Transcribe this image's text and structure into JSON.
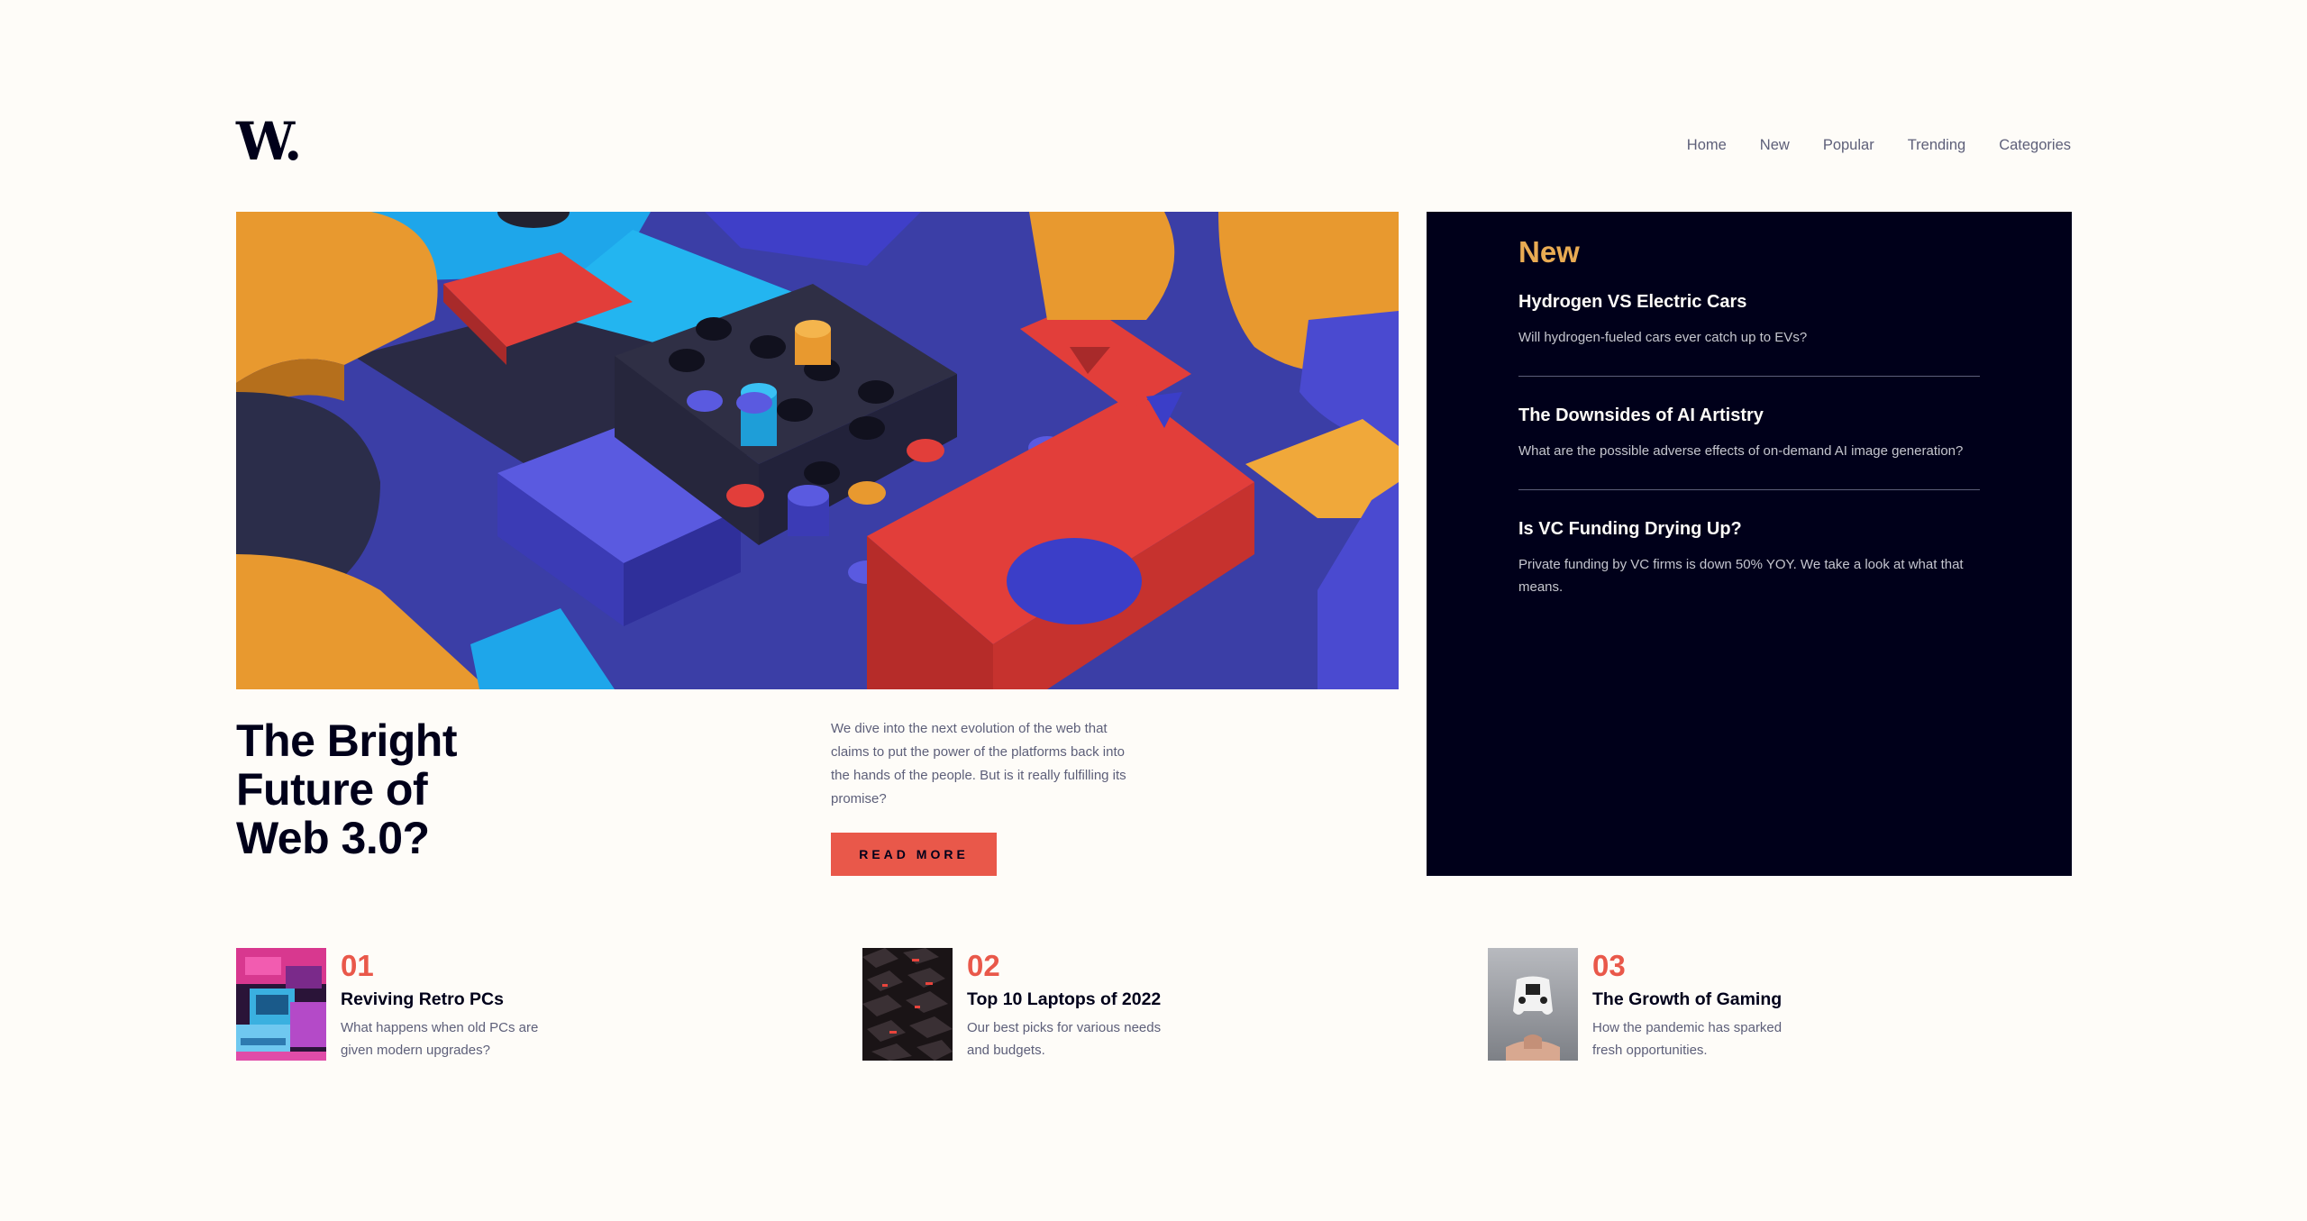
{
  "header": {
    "logo": "W.",
    "nav": [
      "Home",
      "New",
      "Popular",
      "Trending",
      "Categories"
    ]
  },
  "hero": {
    "title": "The Bright\nFuture of\nWeb 3.0?",
    "description": "We dive into the next evolution of the web that claims to put the power of the platforms back into the hands of the people. But is it really fulfilling its promise?",
    "button": "READ MORE",
    "image_icon": "abstract-3d-blocks-image"
  },
  "new_panel": {
    "heading": "New",
    "items": [
      {
        "title": "Hydrogen VS Electric Cars",
        "text": "Will hydrogen-fueled cars ever catch up to EVs?"
      },
      {
        "title": "The Downsides of AI Artistry",
        "text": "What are the possible adverse effects of on-demand AI image generation?"
      },
      {
        "title": "Is VC Funding Drying Up?",
        "text": "Private funding by VC firms is down 50% YOY. We take a look at what that means."
      }
    ]
  },
  "cards": [
    {
      "num": "01",
      "title": "Reviving Retro PCs",
      "text": "What happens when old PCs are given modern upgrades?",
      "image_icon": "retro-pc-image"
    },
    {
      "num": "02",
      "title": "Top 10 Laptops of 2022",
      "text": "Our best picks for various needs and budgets.",
      "image_icon": "laptop-keyboard-image"
    },
    {
      "num": "03",
      "title": "The Growth of Gaming",
      "text": "How the pandemic has sparked fresh opportunities.",
      "image_icon": "game-controller-image"
    }
  ],
  "colors": {
    "background": "#fefcf8",
    "dark_navy": "#00001a",
    "soft_red": "#e9584a",
    "soft_orange": "#e9ab53",
    "grayish_blue": "#5d5f79"
  }
}
